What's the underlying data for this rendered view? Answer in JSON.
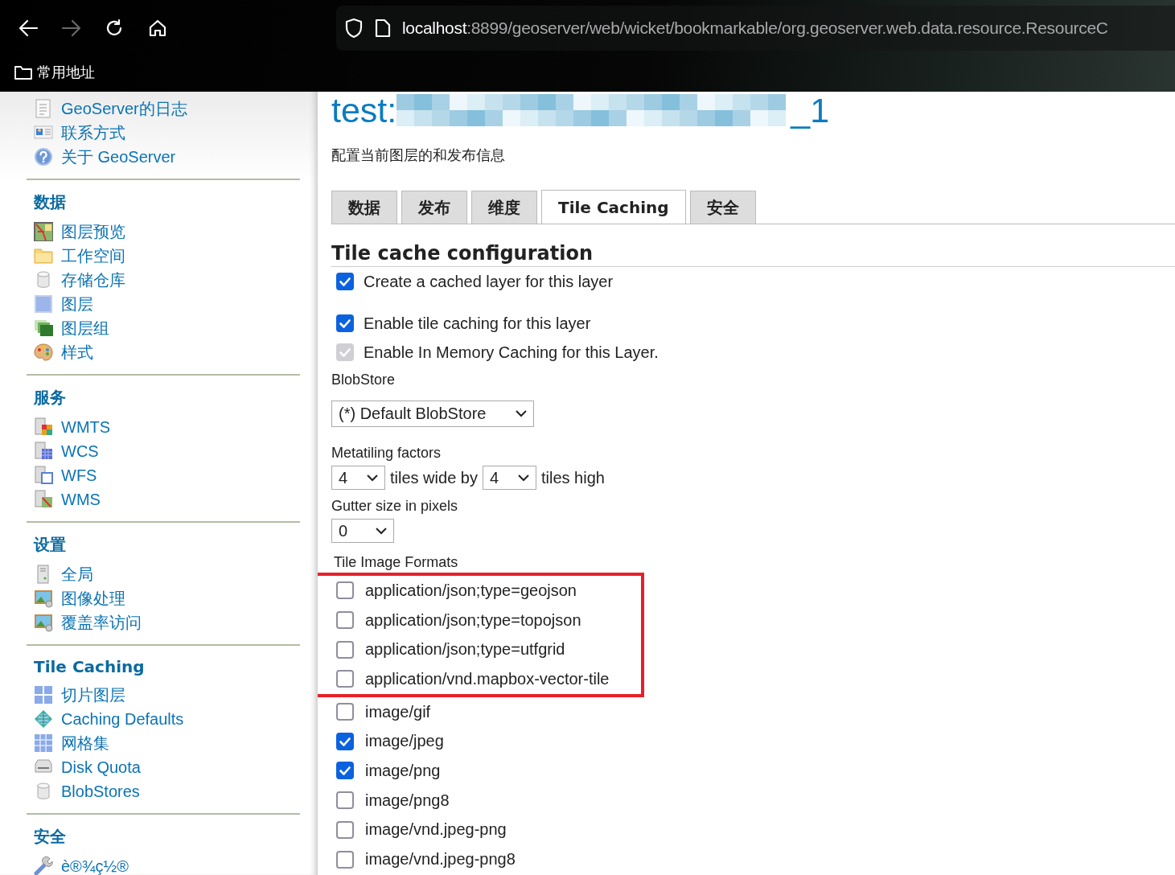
{
  "browser": {
    "url_host": "localhost",
    "url_rest": ":8899/geoserver/web/wicket/bookmarkable/org.geoserver.web.data.resource.ResourceC",
    "forward_disabled": true,
    "bookmarks": [
      {
        "label": "常用地址"
      }
    ]
  },
  "sidebar": {
    "sections": [
      {
        "items": [
          {
            "label": "GeoServer的日志"
          },
          {
            "label": "联系方式"
          },
          {
            "label": "关于 GeoServer"
          }
        ]
      },
      {
        "heading": "数据",
        "items": [
          {
            "label": "图层预览"
          },
          {
            "label": "工作空间"
          },
          {
            "label": "存储仓库"
          },
          {
            "label": "图层"
          },
          {
            "label": "图层组"
          },
          {
            "label": "样式"
          }
        ]
      },
      {
        "heading": "服务",
        "items": [
          {
            "label": "WMTS"
          },
          {
            "label": "WCS"
          },
          {
            "label": "WFS"
          },
          {
            "label": "WMS"
          }
        ]
      },
      {
        "heading": "设置",
        "items": [
          {
            "label": "全局"
          },
          {
            "label": "图像处理"
          },
          {
            "label": "覆盖率访问"
          }
        ]
      },
      {
        "heading": "Tile Caching",
        "items": [
          {
            "label": "切片图层"
          },
          {
            "label": "Caching Defaults"
          },
          {
            "label": "网格集"
          },
          {
            "label": "Disk Quota"
          },
          {
            "label": "BlobStores"
          }
        ]
      },
      {
        "heading": "安全",
        "items": [
          {
            "label": "è®¾ç½®"
          }
        ]
      }
    ]
  },
  "page": {
    "title_prefix": "test:",
    "title_redacted": true,
    "title_suffix": "_1",
    "subtitle": "配置当前图层的和发布信息",
    "tabs": [
      {
        "label": "数据",
        "selected": false
      },
      {
        "label": "发布",
        "selected": false
      },
      {
        "label": "维度",
        "selected": false
      },
      {
        "label": "Tile Caching",
        "selected": true
      },
      {
        "label": "安全",
        "selected": false
      }
    ],
    "section_title": "Tile cache configuration",
    "options": [
      {
        "label": "Create a cached layer for this layer",
        "checked": true,
        "disabled": false
      },
      {
        "label": "Enable tile caching for this layer",
        "checked": true,
        "disabled": false
      },
      {
        "label": "Enable In Memory Caching for this Layer.",
        "checked": true,
        "disabled": true
      }
    ],
    "blobstore_label": "BlobStore",
    "blobstore_value": "(*) Default BlobStore",
    "metatiling_label": "Metatiling factors",
    "meta_wide": "4",
    "meta_wide_text": "tiles wide by",
    "meta_high": "4",
    "meta_high_text": "tiles high",
    "gutter_label": "Gutter size in pixels",
    "gutter_value": "0",
    "formats_label": "Tile Image Formats",
    "formats": [
      {
        "label": "application/json;type=geojson",
        "checked": false,
        "highlighted": true
      },
      {
        "label": "application/json;type=topojson",
        "checked": false,
        "highlighted": true
      },
      {
        "label": "application/json;type=utfgrid",
        "checked": false,
        "highlighted": true
      },
      {
        "label": "application/vnd.mapbox-vector-tile",
        "checked": false,
        "highlighted": true
      },
      {
        "label": "image/gif",
        "checked": false,
        "highlighted": false
      },
      {
        "label": "image/jpeg",
        "checked": true,
        "highlighted": false
      },
      {
        "label": "image/png",
        "checked": true,
        "highlighted": false
      },
      {
        "label": "image/png8",
        "checked": false,
        "highlighted": false
      },
      {
        "label": "image/vnd.jpeg-png",
        "checked": false,
        "highlighted": false
      },
      {
        "label": "image/vnd.jpeg-png8",
        "checked": false,
        "highlighted": false
      }
    ]
  }
}
